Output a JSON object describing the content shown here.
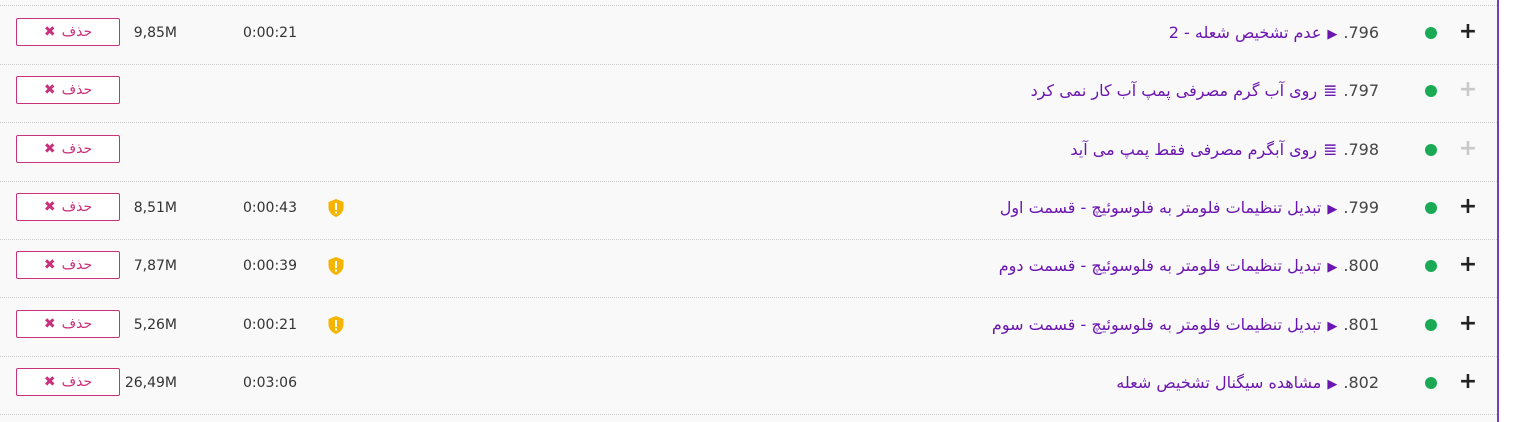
{
  "rows": [
    {
      "num": ".796",
      "icon": "play-icon",
      "title": "عدم تشخیص شعله - 2",
      "duration": "0:00:21",
      "size": "9,85M",
      "warning": false,
      "expand_muted": false
    },
    {
      "num": ".797",
      "icon": "list-icon",
      "title": "روی آب گرم مصرفی پمپ آب کار نمی کرد",
      "duration": "",
      "size": "",
      "warning": false,
      "expand_muted": true
    },
    {
      "num": ".798",
      "icon": "list-icon",
      "title": "روی آبگرم مصرفی فقط پمپ می آید",
      "duration": "",
      "size": "",
      "warning": false,
      "expand_muted": true
    },
    {
      "num": ".799",
      "icon": "play-icon",
      "title": "تبدیل تنظیمات فلومتر به فلوسوئیچ - قسمت اول",
      "duration": "0:00:43",
      "size": "8,51M",
      "warning": true,
      "expand_muted": false
    },
    {
      "num": ".800",
      "icon": "play-icon",
      "title": "تبدیل تنظیمات فلومتر به فلوسوئیچ - قسمت دوم",
      "duration": "0:00:39",
      "size": "7,87M",
      "warning": true,
      "expand_muted": false
    },
    {
      "num": ".801",
      "icon": "play-icon",
      "title": "تبدیل تنظیمات فلومتر به فلوسوئیچ - قسمت سوم",
      "duration": "0:00:21",
      "size": "5,26M",
      "warning": true,
      "expand_muted": false
    },
    {
      "num": ".802",
      "icon": "play-icon",
      "title": "مشاهده سیگنال تشخیص شعله",
      "duration": "0:03:06",
      "size": "26,49M",
      "warning": false,
      "expand_muted": false
    }
  ],
  "labels": {
    "delete": "حذف",
    "expand_glyph": "+",
    "play_glyph": "▶",
    "list_glyph": "≣",
    "delete_glyph": "✖"
  },
  "colors": {
    "accent": "#6b16b0",
    "status_green": "#1aaa55",
    "delete": "#c8317c",
    "warning": "#f5b400"
  }
}
